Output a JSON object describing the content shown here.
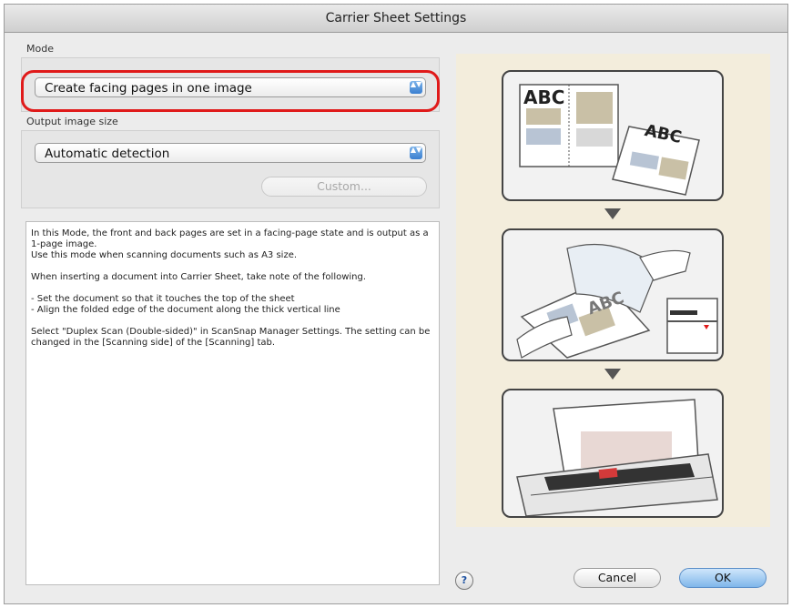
{
  "window": {
    "title": "Carrier Sheet Settings"
  },
  "mode": {
    "label": "Mode",
    "selected": "Create facing pages in one image",
    "stepper_icon": "▲▼"
  },
  "output": {
    "label": "Output image size",
    "selected": "Automatic detection",
    "custom_button": "Custom..."
  },
  "description": "In this Mode, the front and back pages are set in a facing-page state and is output as a 1-page image.\nUse this mode when scanning documents such as A3 size.\n\nWhen inserting a document into Carrier Sheet, take note of the following.\n\n - Set the document so that it touches the top of the sheet\n - Align the folded edge of the document along the thick vertical line\n\nSelect \"Duplex Scan (Double-sided)\" in ScanSnap Manager Settings. The setting can be changed in the [Scanning side] of the [Scanning] tab.",
  "illustration": {
    "panel1_text_left": "ABC",
    "panel1_text_right": "ABC",
    "panel2_text": "ABC"
  },
  "footer": {
    "help_label": "?",
    "cancel_label": "Cancel",
    "ok_label": "OK"
  },
  "colors": {
    "highlight": "#e01a1a",
    "accent": "#3a7fd0",
    "illustration_bg": "#f3eddc"
  }
}
